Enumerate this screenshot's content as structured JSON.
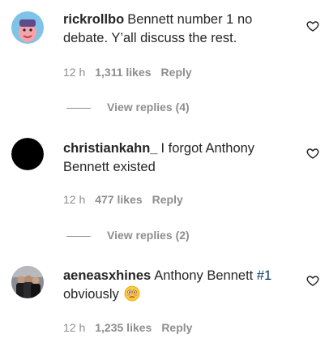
{
  "comments": [
    {
      "username": "rickrollbo",
      "text": "Bennett number 1 no debate. Y’all discuss the rest.",
      "time": "12 h",
      "likes": "1,311 likes",
      "reply_label": "Reply",
      "view_replies": "View replies (4)",
      "avatar": "cartoon-face-avatar"
    },
    {
      "username": "christiankahn_",
      "text": "I forgot Anthony Bennett existed",
      "time": "12 h",
      "likes": "477 likes",
      "reply_label": "Reply",
      "view_replies": "View replies (2)",
      "avatar": "black-circle-avatar"
    },
    {
      "username": "aeneasxhines",
      "text_before": "Anthony Bennett ",
      "mention": "#1",
      "text_after": " obviously",
      "emoji": "flushed-face-emoji",
      "time": "12 h",
      "likes": "1,235 likes",
      "reply_label": "Reply",
      "avatar": "group-photo-avatar"
    }
  ],
  "icons": {
    "like": "heart-outline-icon"
  },
  "colors": {
    "text": "#262626",
    "meta": "#8e8e8e",
    "hashtag": "#00376b"
  }
}
